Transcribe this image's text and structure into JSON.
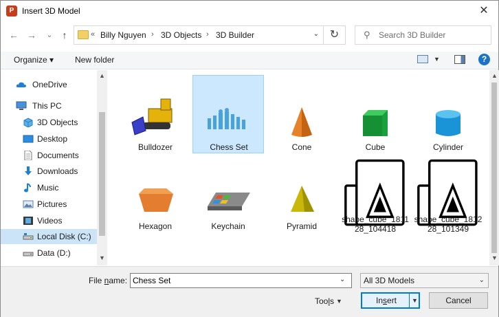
{
  "window": {
    "title": "Insert 3D Model",
    "app_icon_letter": "P",
    "close_glyph": "✕"
  },
  "nav_buttons": {
    "back": "←",
    "forward": "→",
    "recent": "⌄",
    "up": "↑"
  },
  "address": {
    "overflow": "«",
    "crumbs": [
      "Billy Nguyen",
      "3D Objects",
      "3D Builder"
    ],
    "separator": "›",
    "dropdown": "⌄",
    "refresh_glyph": "↻"
  },
  "search": {
    "placeholder": "Search 3D Builder",
    "value": ""
  },
  "toolbar": {
    "organize": "Organize ▾",
    "new_folder": "New folder",
    "view_caret": "▼",
    "help": "?"
  },
  "nav": {
    "items": [
      {
        "label": "OneDrive",
        "icon": "cloud-icon",
        "selected": false
      },
      {
        "label": "This PC",
        "icon": "computer-icon",
        "selected": false
      },
      {
        "label": "3D Objects",
        "icon": "cube-icon",
        "selected": false
      },
      {
        "label": "Desktop",
        "icon": "desktop-icon",
        "selected": false
      },
      {
        "label": "Documents",
        "icon": "document-icon",
        "selected": false
      },
      {
        "label": "Downloads",
        "icon": "download-icon",
        "selected": false
      },
      {
        "label": "Music",
        "icon": "music-icon",
        "selected": false
      },
      {
        "label": "Pictures",
        "icon": "picture-icon",
        "selected": false
      },
      {
        "label": "Videos",
        "icon": "video-icon",
        "selected": false
      },
      {
        "label": "Local Disk (C:)",
        "icon": "drive-icon",
        "selected": true
      },
      {
        "label": "Data (D:)",
        "icon": "drive-icon",
        "selected": false
      }
    ],
    "scroll_up": "▲",
    "scroll_down": "▼"
  },
  "files": [
    {
      "name": "Bulldozer",
      "thumb": "bulldozer-icon",
      "selected": false
    },
    {
      "name": "Chess Set",
      "thumb": "chess-set-icon",
      "selected": true
    },
    {
      "name": "Cone",
      "thumb": "cone-icon",
      "selected": false
    },
    {
      "name": "Cube",
      "thumb": "cube-icon",
      "selected": false
    },
    {
      "name": "Cylinder",
      "thumb": "cylinder-icon",
      "selected": false
    },
    {
      "name": "Hexagon",
      "thumb": "hexagon-icon",
      "selected": false
    },
    {
      "name": "Keychain",
      "thumb": "keychain-icon",
      "selected": false
    },
    {
      "name": "Pyramid",
      "thumb": "pyramid-icon",
      "selected": false
    },
    {
      "name_line1": "shape_cube_1811",
      "name_line2": "28_104418",
      "thumb": "generic-3d-file-icon",
      "selected": false
    },
    {
      "name_line1": "shape_cube_1812",
      "name_line2": "28_101349",
      "thumb": "generic-3d-file-icon",
      "selected": false
    }
  ],
  "content_scroll": {
    "up": "▲",
    "down": "▼"
  },
  "footer": {
    "file_name_label_pre": "File ",
    "file_name_label_acc": "n",
    "file_name_label_post": "ame:",
    "file_name_value": "Chess Set",
    "file_name_dd": "⌄",
    "filter": "All 3D Models",
    "filter_dd": "⌄",
    "tools_pre": "Too",
    "tools_acc": "l",
    "tools_post": "s",
    "tools_caret": "▼",
    "insert_pre": "In",
    "insert_acc": "s",
    "insert_post": "ert",
    "insert_caret": "▼",
    "cancel": "Cancel"
  },
  "colors": {
    "selection": "#cce8ff",
    "accent": "#0078d7",
    "app_icon": "#c43e1c"
  }
}
